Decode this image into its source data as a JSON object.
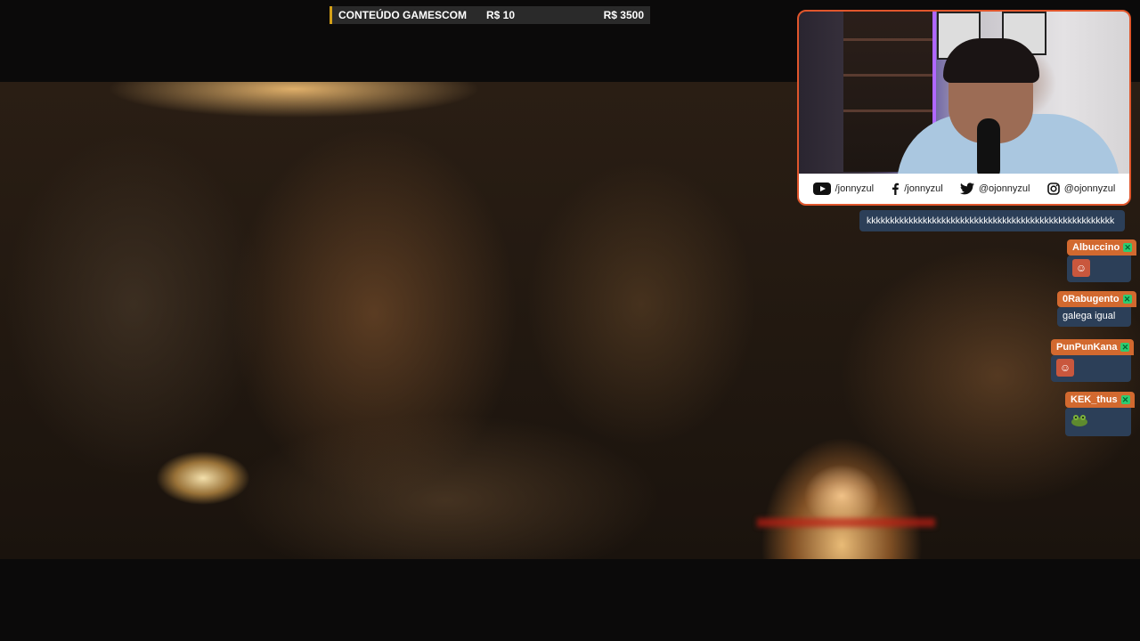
{
  "goal": {
    "label": "CONTEÚDO GAMESCOM",
    "current": "R$ 10",
    "target": "R$ 3500",
    "progress_percent": 0.3,
    "accent": "#d4a017"
  },
  "socials": [
    {
      "icon": "youtube-icon",
      "handle": "/jonnyzul"
    },
    {
      "icon": "facebook-icon",
      "handle": "/jonnyzul"
    },
    {
      "icon": "twitter-icon",
      "handle": "@ojonnyzul"
    },
    {
      "icon": "instagram-icon",
      "handle": "@ojonnyzul"
    }
  ],
  "chat": {
    "previous_message": "kkkkkkkkkkkkkkkkkkkkkkkkkkkkkkkkkkkkkkkkkkkkkkkkkkkkk",
    "messages": [
      {
        "user": "Albuccino",
        "text": "",
        "emote": "face-emote"
      },
      {
        "user": "0Rabugento",
        "text": "galega igual",
        "emote": ""
      },
      {
        "user": "PunPunKana",
        "text": "",
        "emote": "face-emote"
      },
      {
        "user": "KEK_thus",
        "text": "",
        "emote": "frog-emote"
      }
    ],
    "username_color": "#d2692f",
    "bubble_color": "#2c3f58"
  },
  "webcam_border_color": "#e0562c"
}
